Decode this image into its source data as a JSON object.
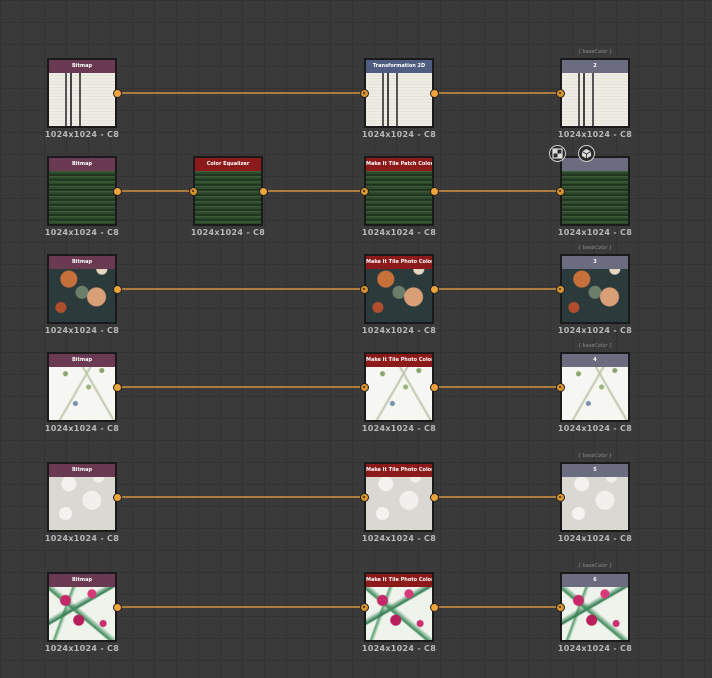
{
  "graph": {
    "accent_color": "#f0a33a",
    "rows": [
      {
        "nodes": [
          {
            "header": "Bitmap",
            "header_class": "bitmap",
            "texture": "stripe",
            "resolution": "1024x1024 - C8"
          },
          {
            "header": "Transformation 2D",
            "header_class": "transform",
            "texture": "stripe",
            "resolution": "1024x1024 - C8"
          },
          {
            "header": "2",
            "header_class": "output",
            "texture": "stripe",
            "resolution": "1024x1024 - C8",
            "tag": "{ baseColor }"
          }
        ]
      },
      {
        "nodes": [
          {
            "header": "Bitmap",
            "header_class": "bitmap",
            "texture": "green",
            "resolution": "1024x1024 - C8"
          },
          {
            "header": "Color Equalizer",
            "header_class": "filter",
            "texture": "green",
            "resolution": "1024x1024 - C8"
          },
          {
            "header": "Make It Tile Patch Color",
            "header_class": "filter",
            "texture": "green",
            "resolution": "1024x1024 - C8"
          },
          {
            "header": "",
            "header_class": "output",
            "texture": "green",
            "resolution": "1024x1024 - C8"
          }
        ]
      },
      {
        "nodes": [
          {
            "header": "Bitmap",
            "header_class": "bitmap",
            "texture": "floral",
            "resolution": "1024x1024 - C8"
          },
          {
            "header": "Make It Tile Photo Color",
            "header_class": "filter",
            "texture": "floral",
            "resolution": "1024x1024 - C8"
          },
          {
            "header": "3",
            "header_class": "output",
            "texture": "floral",
            "resolution": "1024x1024 - C8",
            "tag": "{ baseColor }"
          }
        ]
      },
      {
        "nodes": [
          {
            "header": "Bitmap",
            "header_class": "bitmap",
            "texture": "vine",
            "resolution": "1024x1024 - C8"
          },
          {
            "header": "Make It Tile Photo Color",
            "header_class": "filter",
            "texture": "vine",
            "resolution": "1024x1024 - C8"
          },
          {
            "header": "4",
            "header_class": "output",
            "texture": "vine",
            "resolution": "1024x1024 - C8",
            "tag": "{ baseColor }"
          }
        ]
      },
      {
        "nodes": [
          {
            "header": "Bitmap",
            "header_class": "bitmap",
            "texture": "lace",
            "resolution": "1024x1024 - C8"
          },
          {
            "header": "Make It Tile Photo Color",
            "header_class": "filter",
            "texture": "lace",
            "resolution": "1024x1024 - C8"
          },
          {
            "header": "5",
            "header_class": "output",
            "texture": "lace",
            "resolution": "1024x1024 - C8",
            "tag": "{ baseColor }"
          }
        ]
      },
      {
        "nodes": [
          {
            "header": "Bitmap",
            "header_class": "bitmap",
            "texture": "tropical",
            "resolution": "1024x1024 - C8"
          },
          {
            "header": "Make It Tile Photo Color",
            "header_class": "filter",
            "texture": "tropical",
            "resolution": "1024x1024 - C8"
          },
          {
            "header": "6",
            "header_class": "output",
            "texture": "tropical",
            "resolution": "1024x1024 - C8",
            "tag": "{ baseColor }"
          }
        ]
      }
    ],
    "icons": [
      "view-2d-icon",
      "view-3d-icon"
    ]
  }
}
